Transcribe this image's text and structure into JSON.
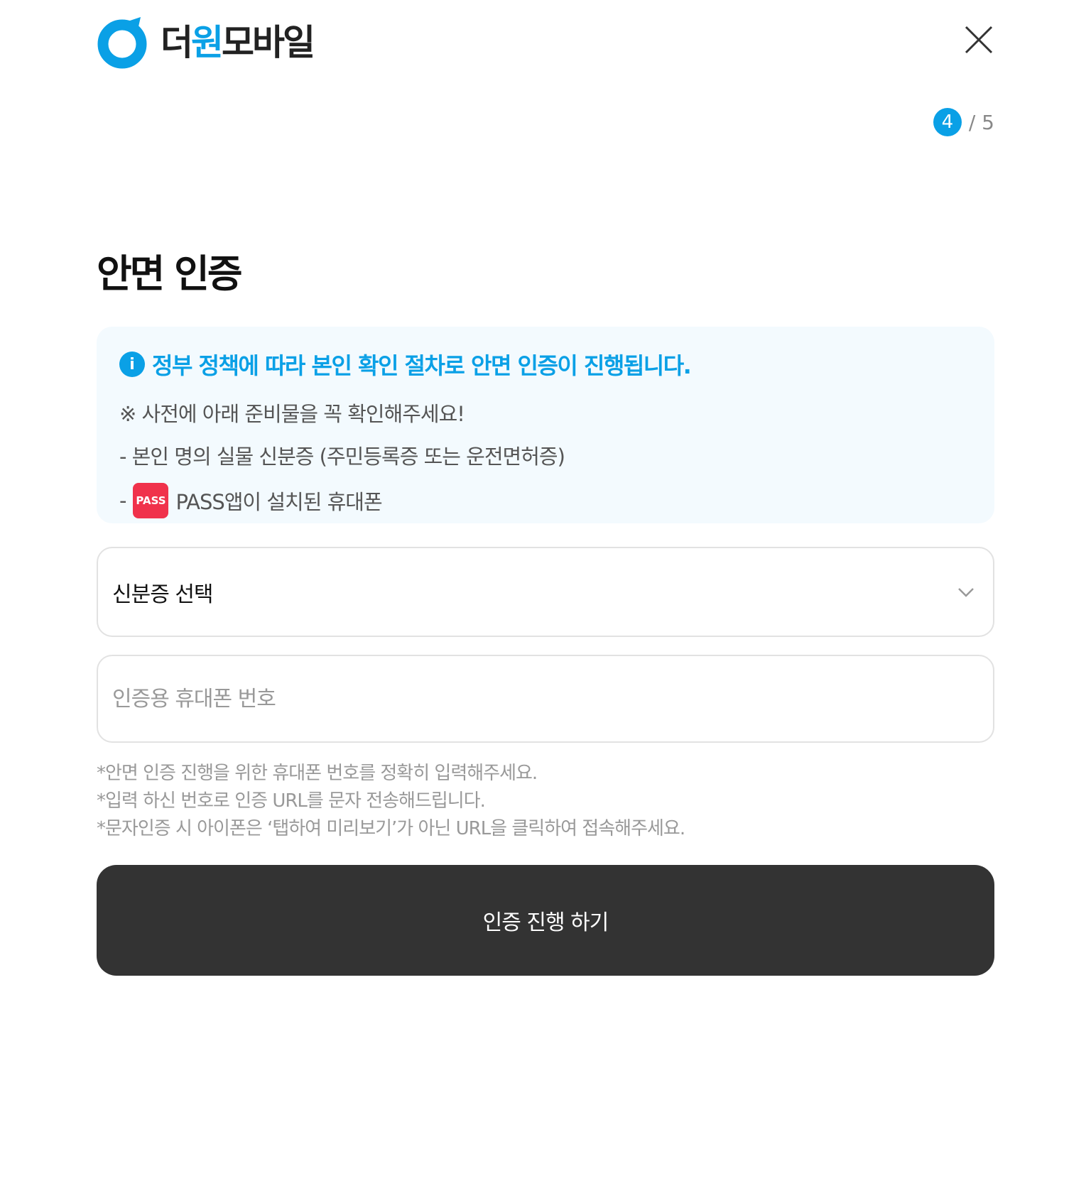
{
  "header": {
    "logo_text_prefix": "더",
    "logo_text_accent": "원",
    "logo_text_suffix": "모바일",
    "close_icon": "close-icon",
    "brand_color": "#0aa0e6"
  },
  "step": {
    "current": "4",
    "total": "/ 5"
  },
  "title": "안면 인증",
  "info": {
    "icon": "info-icon",
    "heading": "정부 정책에 따라 본인 확인 절차로 안면 인증이 진행됩니다.",
    "line1": "※ 사전에 아래 준비물을 꼭 확인해주세요!",
    "line2": "- 본인 명의 실물 신분증 (주민등록증 또는 운전면허증)",
    "line3_dash": "-",
    "pass_badge": "PASS",
    "line3_text": "PASS앱이 설치된 휴대폰"
  },
  "form": {
    "id_select_label": "신분증 선택",
    "phone_placeholder": "인증용 휴대폰 번호",
    "phone_value": ""
  },
  "notes": [
    "*안면 인증 진행을 위한 휴대폰 번호를 정확히 입력해주세요.",
    "*입력 하신 번호로 인증 URL를 문자 전송해드립니다.",
    "*문자인증 시 아이폰은 ‘탭하여 미리보기’가 아닌 URL을 클릭하여 접속해주세요."
  ],
  "submit_label": "인증 진행 하기"
}
